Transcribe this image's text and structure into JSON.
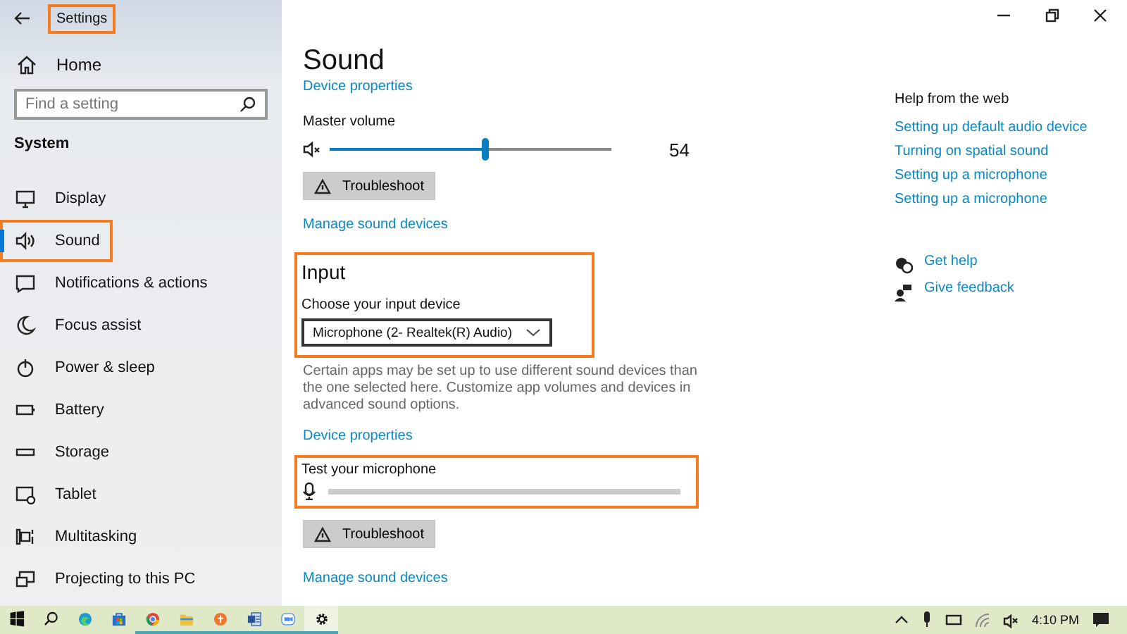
{
  "window": {
    "title": "Settings",
    "title_highlighted": true
  },
  "sidebar": {
    "home": "Home",
    "search": {
      "placeholder": "Find a setting"
    },
    "section": "System",
    "items": [
      {
        "label": "Display",
        "selected": false,
        "highlighted": false
      },
      {
        "label": "Sound",
        "selected": true,
        "highlighted": true
      },
      {
        "label": "Notifications & actions",
        "selected": false,
        "highlighted": false
      },
      {
        "label": "Focus assist",
        "selected": false,
        "highlighted": false
      },
      {
        "label": "Power & sleep",
        "selected": false,
        "highlighted": false
      },
      {
        "label": "Battery",
        "selected": false,
        "highlighted": false
      },
      {
        "label": "Storage",
        "selected": false,
        "highlighted": false
      },
      {
        "label": "Tablet",
        "selected": false,
        "highlighted": false
      },
      {
        "label": "Multitasking",
        "selected": false,
        "highlighted": false
      },
      {
        "label": "Projecting to this PC",
        "selected": false,
        "highlighted": false
      }
    ]
  },
  "page": {
    "title": "Sound",
    "output": {
      "device_properties": "Device properties",
      "master_volume": {
        "label": "Master volume",
        "muted": true,
        "level": 0.55,
        "reading": "54"
      },
      "troubleshoot": "Troubleshoot",
      "manage": "Manage sound devices"
    },
    "input": {
      "heading": "Input",
      "highlighted": true,
      "device_label": "Choose your input device",
      "device": "Microphone (2- Realtek(R) Audio)",
      "note": "Certain apps may be set up to use different sound devices than the one selected here. Customize app volumes and devices in advanced sound options.",
      "device_properties": "Device properties",
      "test": {
        "label": "Test your microphone",
        "highlighted": true
      },
      "troubleshoot": "Troubleshoot",
      "manage": "Manage sound devices"
    }
  },
  "help": {
    "heading": "Help from the web",
    "links": [
      "Setting up default audio device",
      "Turning on spatial sound",
      "Setting up a microphone",
      "Setting up a microphone"
    ],
    "actions": [
      "Get help",
      "Give feedback"
    ]
  },
  "taskbar": {
    "apps": [
      {
        "running": false,
        "selected": false
      },
      {
        "running": false,
        "selected": false
      },
      {
        "running": false,
        "selected": false
      },
      {
        "running": false,
        "selected": false
      },
      {
        "running": true,
        "selected": false
      },
      {
        "running": true,
        "selected": false
      },
      {
        "running": true,
        "selected": false
      },
      {
        "running": true,
        "selected": false
      },
      {
        "running": true,
        "selected": false
      },
      {
        "running": true,
        "selected": true
      }
    ],
    "clock": "4:10 PM"
  }
}
